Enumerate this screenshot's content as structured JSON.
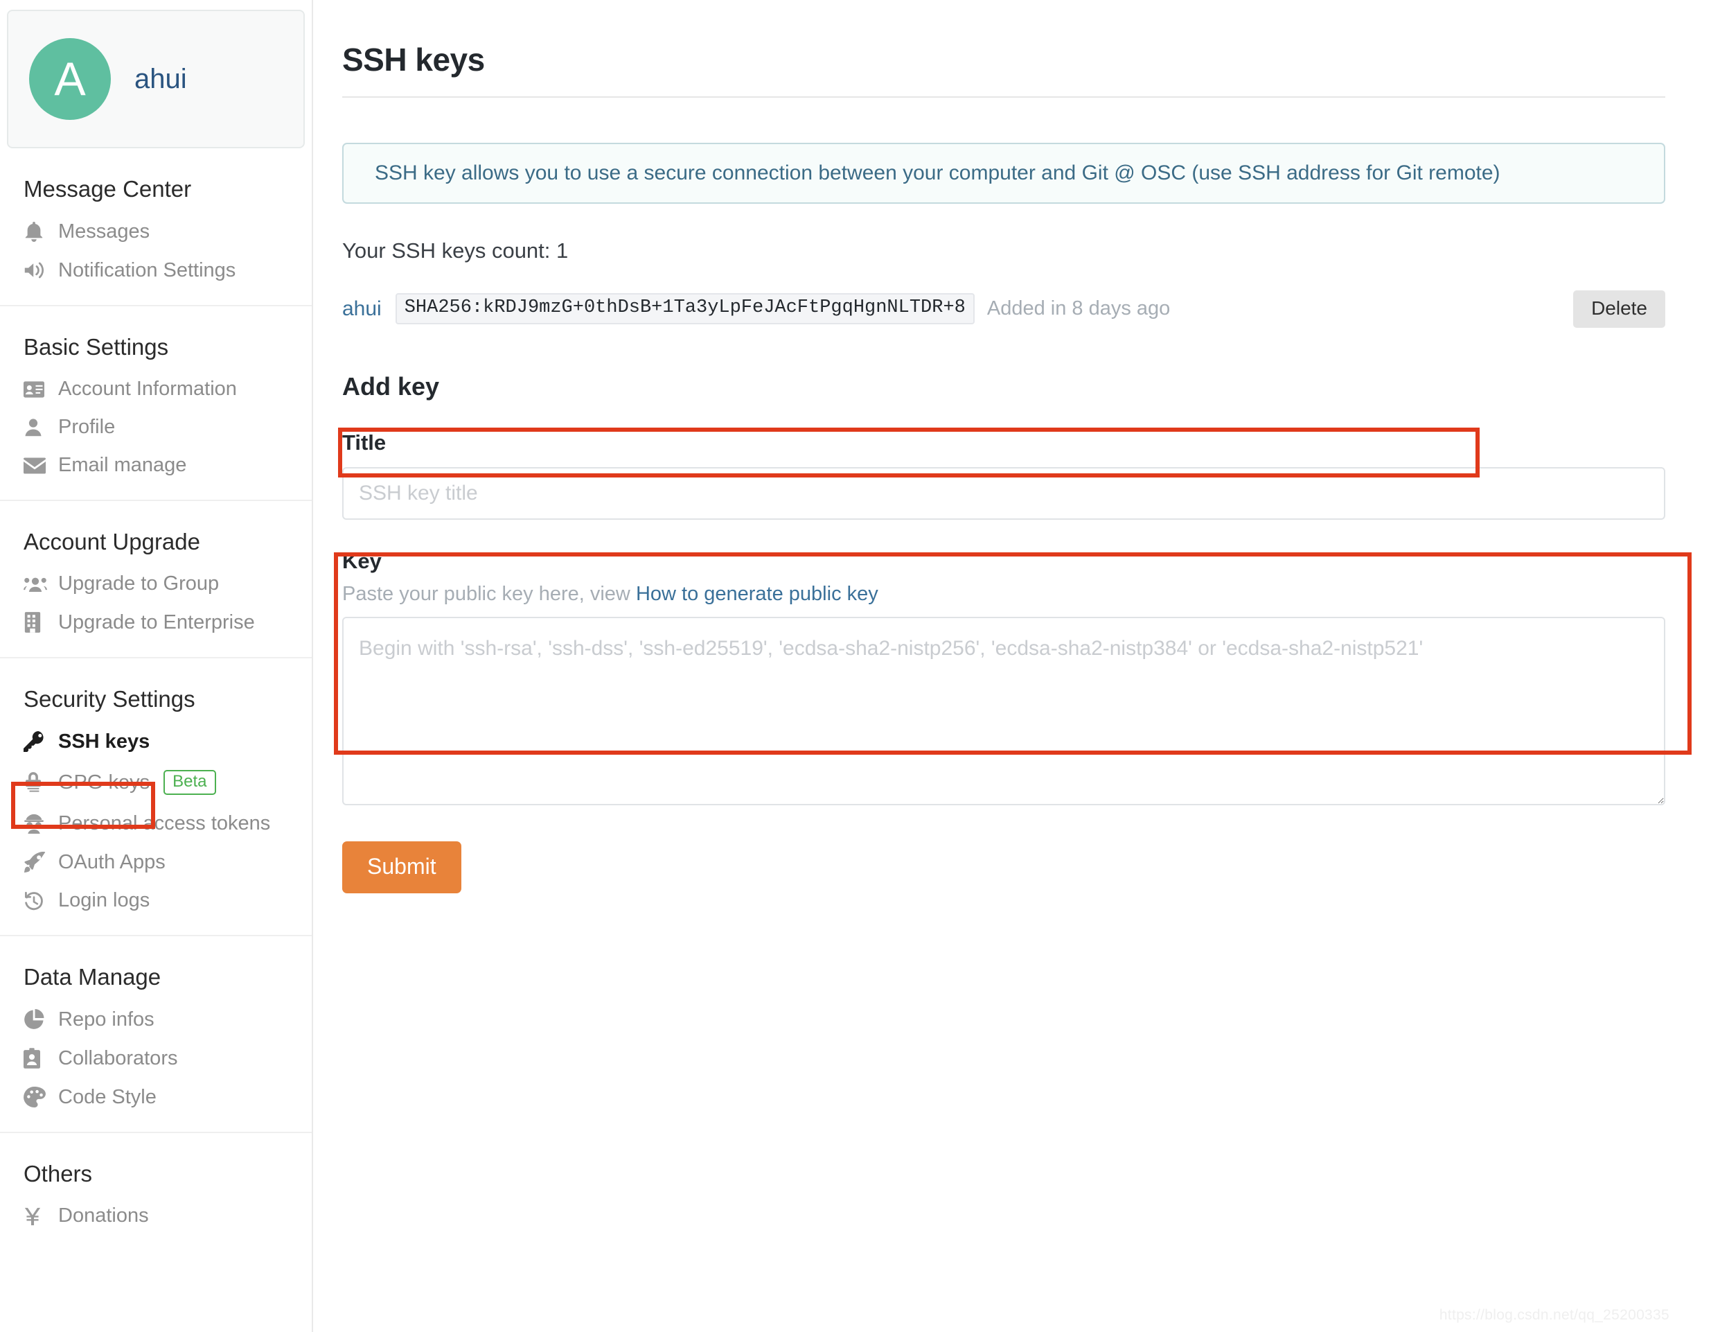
{
  "sidebar": {
    "user": {
      "avatar_initial": "A",
      "name": "ahui"
    },
    "groups": [
      {
        "title": "Message Center",
        "items": [
          {
            "label": "Messages",
            "icon": "bell-icon",
            "active": false
          },
          {
            "label": "Notification Settings",
            "icon": "speaker-icon",
            "active": false
          }
        ]
      },
      {
        "title": "Basic Settings",
        "items": [
          {
            "label": "Account Information",
            "icon": "id-card-icon",
            "active": false
          },
          {
            "label": "Profile",
            "icon": "person-icon",
            "active": false
          },
          {
            "label": "Email manage",
            "icon": "envelope-icon",
            "active": false
          }
        ]
      },
      {
        "title": "Account Upgrade",
        "items": [
          {
            "label": "Upgrade to Group",
            "icon": "users-icon",
            "active": false
          },
          {
            "label": "Upgrade to Enterprise",
            "icon": "building-icon",
            "active": false
          }
        ]
      },
      {
        "title": "Security Settings",
        "items": [
          {
            "label": "SSH keys",
            "icon": "key-icon",
            "active": true
          },
          {
            "label": "GPG keys",
            "icon": "gpg-lock-icon",
            "active": false,
            "badge": "Beta"
          },
          {
            "label": "Personal access tokens",
            "icon": "spy-icon",
            "active": false
          },
          {
            "label": "OAuth Apps",
            "icon": "rocket-icon",
            "active": false
          },
          {
            "label": "Login logs",
            "icon": "history-icon",
            "active": false
          }
        ]
      },
      {
        "title": "Data Manage",
        "items": [
          {
            "label": "Repo infos",
            "icon": "pie-chart-icon",
            "active": false
          },
          {
            "label": "Collaborators",
            "icon": "badge-id-icon",
            "active": false
          },
          {
            "label": "Code Style",
            "icon": "palette-icon",
            "active": false
          }
        ]
      },
      {
        "title": "Others",
        "items": [
          {
            "label": "Donations",
            "icon": "yen-icon",
            "active": false
          }
        ]
      }
    ]
  },
  "main": {
    "page_title": "SSH keys",
    "info_banner": "SSH key allows you to use a secure connection between your computer and Git @ OSC (use SSH address for Git remote)",
    "keys_count_text": "Your SSH keys count: 1",
    "keys": [
      {
        "owner": "ahui",
        "fingerprint": "SHA256:kRDJ9mzG+0thDsB+1Ta3yLpFeJAcFtPgqHgnNLTDR+8",
        "added": "Added in 8 days ago",
        "delete_label": "Delete"
      }
    ],
    "add_key": {
      "heading": "Add key",
      "title_label": "Title",
      "title_value": "",
      "title_placeholder": "SSH key title",
      "key_label": "Key",
      "help_prefix": "Paste your public key here, view ",
      "help_link": "How to generate public key",
      "key_value": "",
      "key_placeholder": "Begin with 'ssh-rsa', 'ssh-dss', 'ssh-ed25519', 'ecdsa-sha2-nistp256', 'ecdsa-sha2-nistp384' or 'ecdsa-sha2-nistp521'",
      "submit_label": "Submit"
    }
  },
  "annotations": {
    "color": "#e03a1b",
    "boxes": [
      "sidebar-ssh-keys",
      "title-input",
      "key-textarea"
    ]
  },
  "watermark": "https://blog.csdn.net/qq_25200335"
}
